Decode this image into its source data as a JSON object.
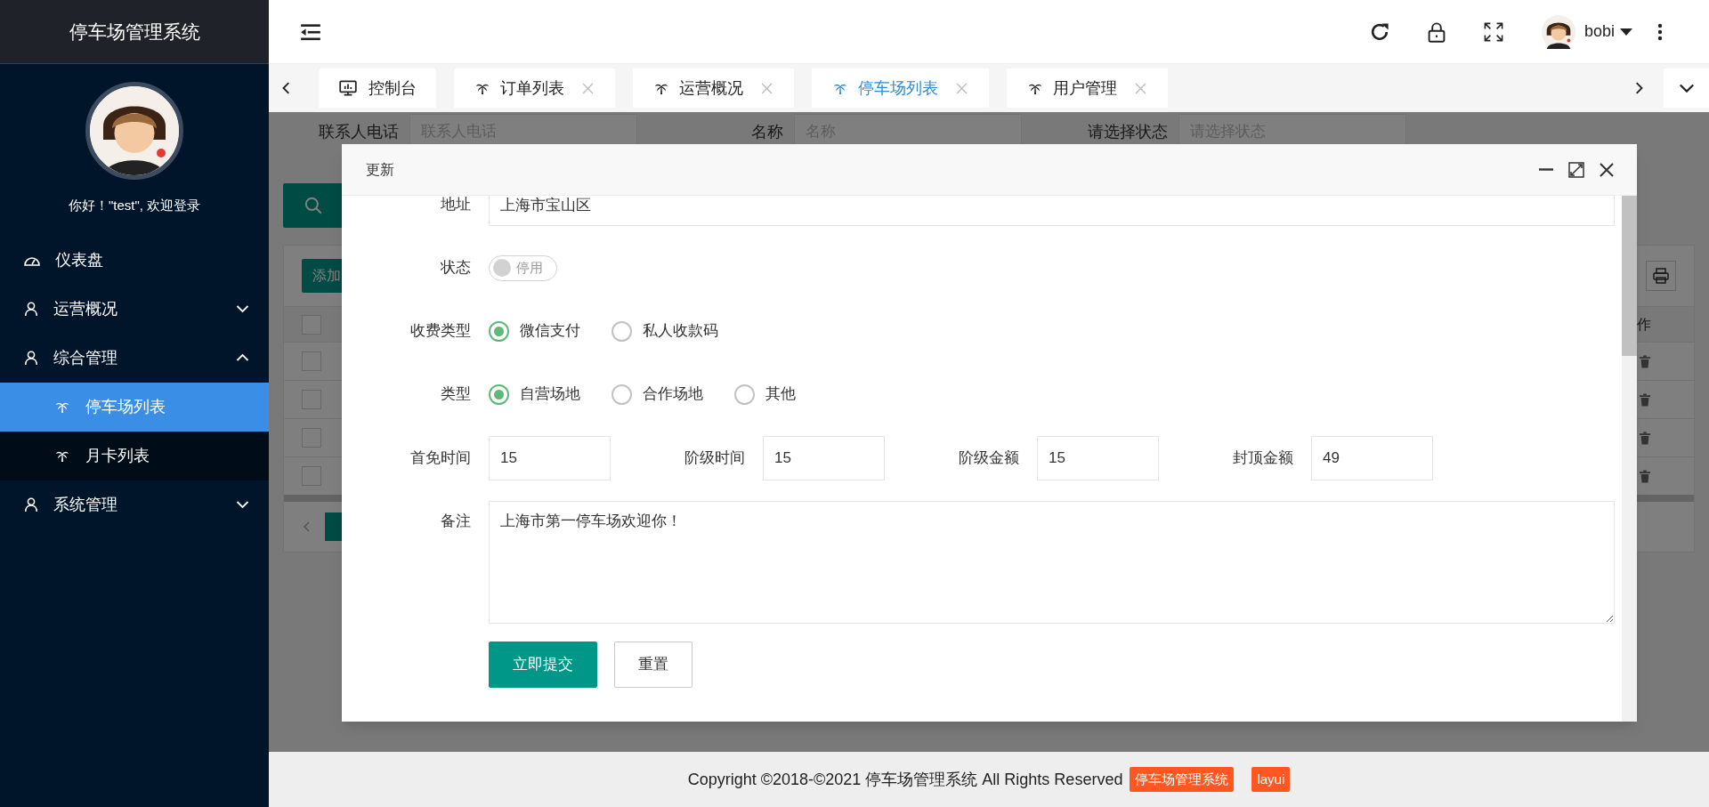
{
  "sidebar": {
    "title": "停车场管理系统",
    "greeting": "你好！\"test\", 欢迎登录",
    "menu": [
      {
        "label": "仪表盘",
        "kind": "dashboard",
        "selected": false
      },
      {
        "label": "运营概况",
        "kind": "group",
        "selected": false,
        "expanded": false
      },
      {
        "label": "综合管理",
        "kind": "group",
        "selected": false,
        "expanded": true,
        "children": [
          {
            "label": "停车场列表",
            "selected": true
          },
          {
            "label": "月卡列表",
            "selected": false
          }
        ]
      },
      {
        "label": "系统管理",
        "kind": "group",
        "selected": false,
        "expanded": false
      }
    ]
  },
  "header": {
    "user": "bobi"
  },
  "tabs": [
    {
      "label": "控制台",
      "kind": "console",
      "selected": false
    },
    {
      "label": "订单列表",
      "kind": "page",
      "selected": false
    },
    {
      "label": "运营概况",
      "kind": "page",
      "selected": false
    },
    {
      "label": "停车场列表",
      "kind": "page",
      "selected": true
    },
    {
      "label": "用户管理",
      "kind": "page",
      "selected": false
    }
  ],
  "background": {
    "search_fields": [
      {
        "label": "联系人电话",
        "placeholder": "联系人电话"
      },
      {
        "label": "名称",
        "placeholder": "名称"
      },
      {
        "label": "请选择状态",
        "placeholder": "请选择状态"
      }
    ],
    "add_button": "添加",
    "last_column": "作",
    "header_checked": false,
    "rows": [
      {
        "checked": false
      },
      {
        "checked": false
      },
      {
        "checked": false
      },
      {
        "checked": false
      }
    ]
  },
  "modal": {
    "title": "更新",
    "fields": [
      {
        "kind": "text",
        "label": "地址",
        "value": "上海市宝山区"
      },
      {
        "kind": "switch",
        "label": "状态",
        "on": false,
        "text": "停用"
      },
      {
        "kind": "radio",
        "label": "收费类型",
        "options": [
          {
            "label": "微信支付",
            "selected": true
          },
          {
            "label": "私人收款码",
            "selected": false
          }
        ]
      },
      {
        "kind": "radio",
        "label": "类型",
        "options": [
          {
            "label": "自营场地",
            "selected": true
          },
          {
            "label": "合作场地",
            "selected": false
          },
          {
            "label": "其他",
            "selected": false
          }
        ]
      },
      {
        "kind": "inline",
        "items": [
          {
            "label": "首免时间",
            "value": "15"
          },
          {
            "label": "阶级时间",
            "value": "15"
          },
          {
            "label": "阶级金额",
            "value": "15"
          },
          {
            "label": "封顶金额",
            "value": "49"
          }
        ]
      },
      {
        "kind": "textarea",
        "label": "备注",
        "value": "上海市第一停车场欢迎你！"
      }
    ],
    "buttons": [
      {
        "label": "立即提交",
        "kind": "primary"
      },
      {
        "label": "重置",
        "kind": "default"
      }
    ]
  },
  "footer": {
    "copyright": "Copyright ©2018-©2021 停车场管理系统 All Rights Reserved",
    "badges": [
      "停车场管理系统",
      "layui"
    ]
  }
}
